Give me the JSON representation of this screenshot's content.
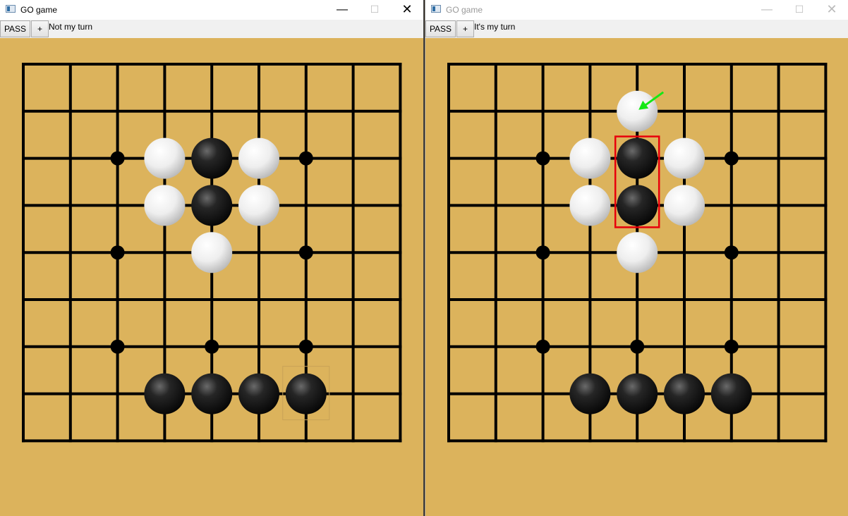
{
  "windows": [
    {
      "id": "left",
      "title": "GO game",
      "pass_label": "PASS",
      "plus_label": "+",
      "status": "Not my turn",
      "stones": [
        {
          "color": "white",
          "col": 3,
          "row": 2
        },
        {
          "color": "black",
          "col": 4,
          "row": 2
        },
        {
          "color": "white",
          "col": 5,
          "row": 2
        },
        {
          "color": "white",
          "col": 3,
          "row": 3
        },
        {
          "color": "black",
          "col": 4,
          "row": 3
        },
        {
          "color": "white",
          "col": 5,
          "row": 3
        },
        {
          "color": "white",
          "col": 4,
          "row": 4
        },
        {
          "color": "black",
          "col": 3,
          "row": 7
        },
        {
          "color": "black",
          "col": 4,
          "row": 7
        },
        {
          "color": "black",
          "col": 5,
          "row": 7
        },
        {
          "color": "black",
          "col": 6,
          "row": 7
        }
      ],
      "hover_cell": {
        "col": 6,
        "row": 7
      }
    },
    {
      "id": "right",
      "title": "GO game",
      "pass_label": "PASS",
      "plus_label": "+",
      "status": "It's my turn",
      "stones": [
        {
          "color": "white",
          "col": 4,
          "row": 1
        },
        {
          "color": "white",
          "col": 3,
          "row": 2
        },
        {
          "color": "black",
          "col": 4,
          "row": 2
        },
        {
          "color": "white",
          "col": 5,
          "row": 2
        },
        {
          "color": "white",
          "col": 3,
          "row": 3
        },
        {
          "color": "black",
          "col": 4,
          "row": 3
        },
        {
          "color": "white",
          "col": 5,
          "row": 3
        },
        {
          "color": "white",
          "col": 4,
          "row": 4
        },
        {
          "color": "black",
          "col": 3,
          "row": 7
        },
        {
          "color": "black",
          "col": 4,
          "row": 7
        },
        {
          "color": "black",
          "col": 5,
          "row": 7
        },
        {
          "color": "black",
          "col": 6,
          "row": 7
        }
      ],
      "highlight": {
        "col": 4,
        "row_start": 2,
        "row_end": 3,
        "color": "#e8000b"
      },
      "arrow": {
        "target_col": 4,
        "target_row": 1,
        "color": "#14e814"
      }
    }
  ],
  "board": {
    "size": 9,
    "star_points": [
      {
        "col": 2,
        "row": 2
      },
      {
        "col": 6,
        "row": 2
      },
      {
        "col": 2,
        "row": 4
      },
      {
        "col": 6,
        "row": 4
      },
      {
        "col": 2,
        "row": 6
      },
      {
        "col": 4,
        "row": 6
      },
      {
        "col": 6,
        "row": 6
      }
    ],
    "background_color": "#dcb35c",
    "line_color": "#000000"
  }
}
